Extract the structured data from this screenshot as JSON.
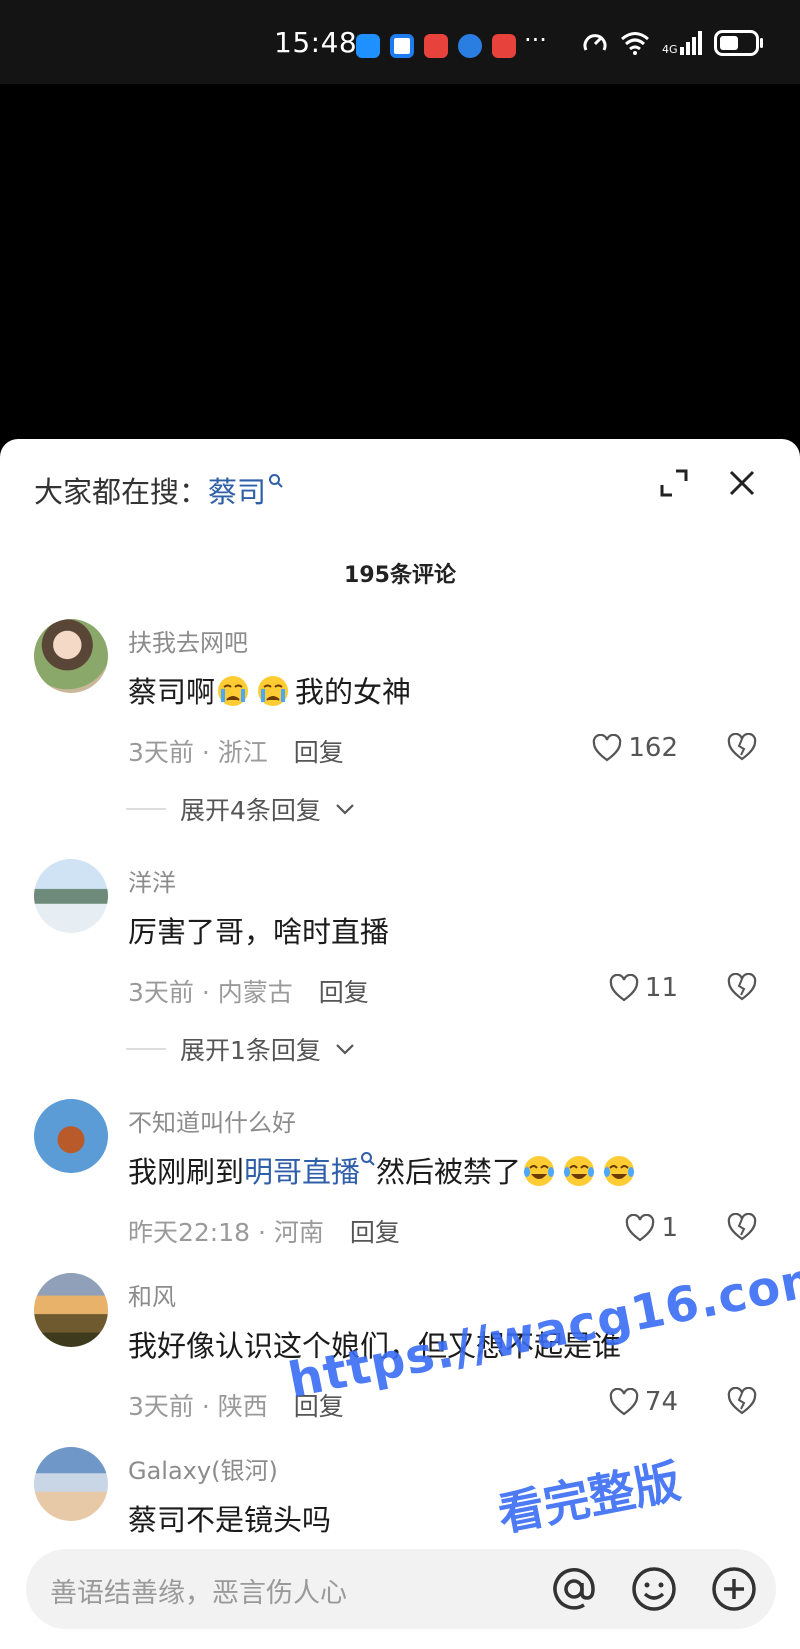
{
  "status_bar": {
    "time": "15:48",
    "network": "4G",
    "app_icon_colors": [
      "#1e90ff",
      "#1e7cf0",
      "#e8423c",
      "#2a7de1",
      "#e8423c"
    ]
  },
  "search_bar": {
    "prefix": "大家都在搜：",
    "term": "蔡司"
  },
  "comments_title": "195条评论",
  "comments": [
    {
      "username": "扶我去网吧",
      "text_before": "蔡司啊",
      "emoji_before": "loudly-crying-face",
      "emoji_count_before": 2,
      "text_after": "我的女神",
      "time": "3天前",
      "location": "浙江",
      "reply_label": "回复",
      "likes": "162",
      "expand_replies": "展开4条回复"
    },
    {
      "username": "洋洋",
      "text": "厉害了哥，啥时直播",
      "time": "3天前",
      "location": "内蒙古",
      "reply_label": "回复",
      "likes": "11",
      "expand_replies": "展开1条回复"
    },
    {
      "username": "不知道叫什么好",
      "text_before": "我刚刷到",
      "link": "明哥直播",
      "text_after": "然后被禁了",
      "emoji_after": "face-with-tears-of-joy",
      "emoji_count_after": 3,
      "time": "昨天22:18",
      "location": "河南",
      "reply_label": "回复",
      "likes": "1"
    },
    {
      "username": "和风",
      "text": "我好像认识这个娘们，但又想不起是谁",
      "time": "3天前",
      "location": "陕西",
      "reply_label": "回复",
      "likes": "74"
    },
    {
      "username": "Galaxy(银河)",
      "text": "蔡司不是镜头吗"
    }
  ],
  "meta_separator": " · ",
  "input_bar": {
    "placeholder": "善语结善缘，恶言伤人心",
    "icons": [
      "at-icon",
      "emoji-icon",
      "add-icon"
    ]
  },
  "watermark": {
    "line1": "https://wacg16.com",
    "line2": "看完整版"
  }
}
